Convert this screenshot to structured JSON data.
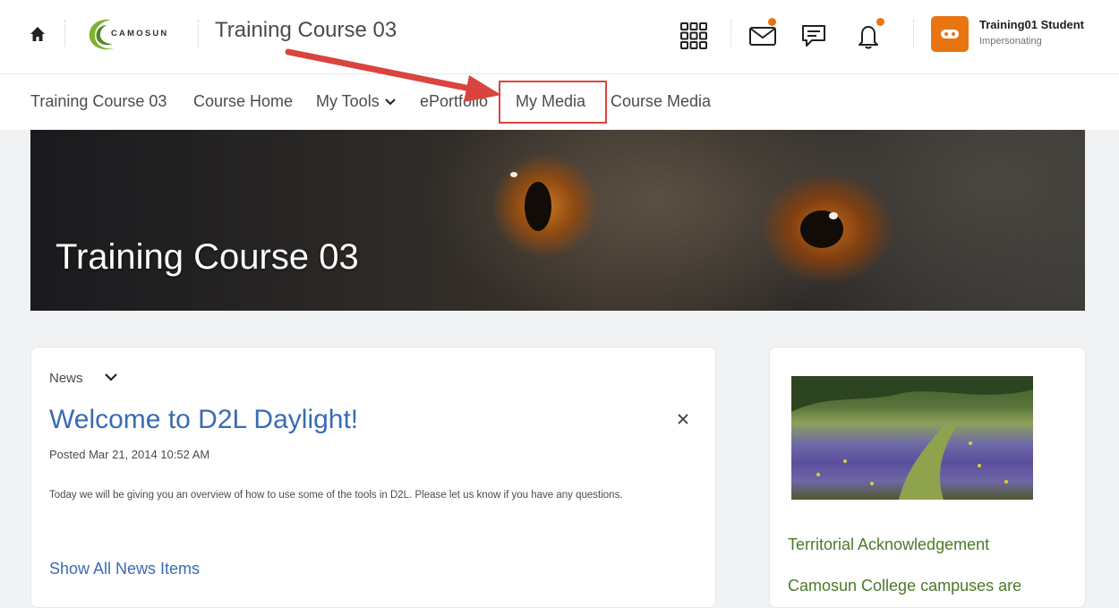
{
  "header": {
    "logo_text": "CAMOSUN",
    "course_title": "Training Course 03",
    "user_name": "Training01 Student",
    "user_status": "Impersonating"
  },
  "nav": {
    "items": [
      {
        "label": "Training Course 03"
      },
      {
        "label": "Course Home"
      },
      {
        "label": "My Tools"
      },
      {
        "label": "ePortfolio"
      },
      {
        "label": "My Media"
      },
      {
        "label": "Course Media"
      }
    ]
  },
  "banner": {
    "title": "Training Course 03"
  },
  "news": {
    "label": "News",
    "title": "Welcome to D2L Daylight!",
    "posted": "Posted Mar 21, 2014 10:52 AM",
    "body": "Today we will be giving you an overview of how to use some of the tools in D2L.  Please let us know if you have any questions.",
    "show_all": "Show All News Items"
  },
  "side": {
    "heading": "Territorial Acknowledgement",
    "text": "Camosun College campuses are"
  },
  "colors": {
    "accent_orange": "#e87511",
    "link_blue": "#3a6bb3",
    "highlight_red": "#d9443f",
    "camosun_green": "#4a7a2a"
  },
  "icons": [
    "home-icon",
    "waffle-grid-icon",
    "mail-icon",
    "chat-icon",
    "bell-icon",
    "chevron-down-icon",
    "close-icon"
  ]
}
